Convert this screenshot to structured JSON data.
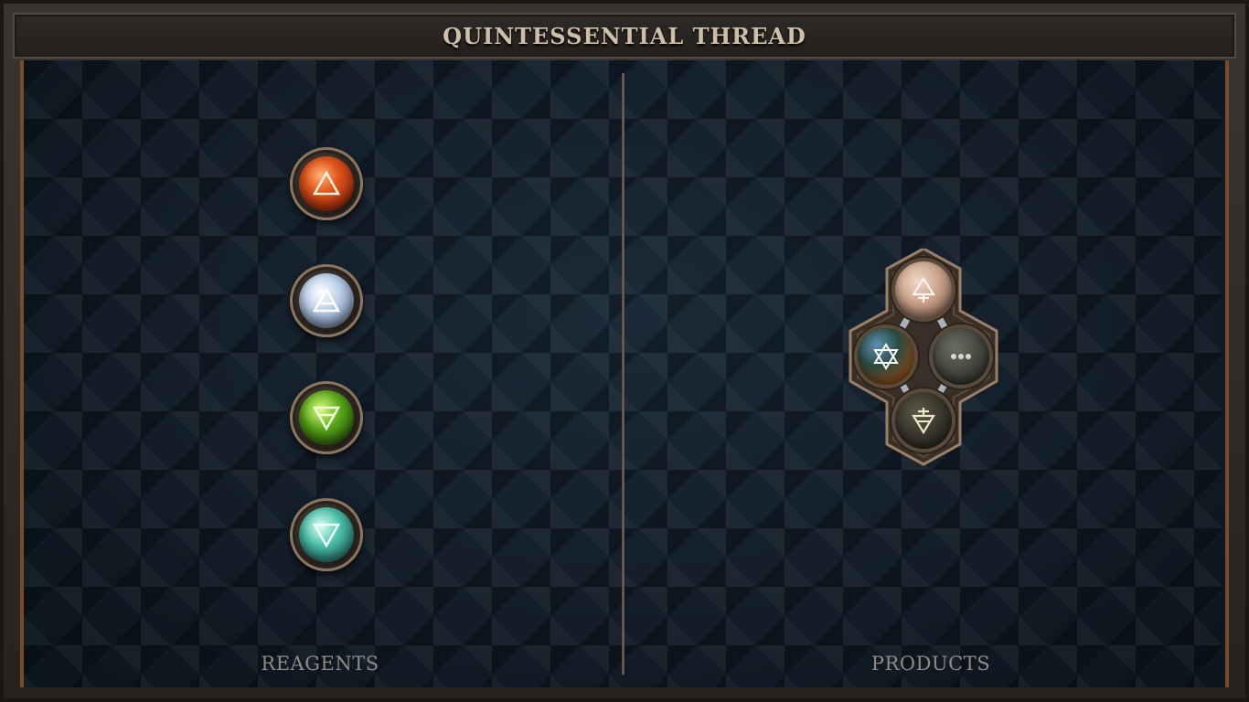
{
  "window": {
    "title": "QUINTESSENTIAL THREAD"
  },
  "panels": {
    "reagents_label": "REAGENTS",
    "products_label": "PRODUCTS"
  },
  "reagents": [
    {
      "element": "fire",
      "icon": "fire-triangle-icon"
    },
    {
      "element": "air",
      "icon": "air-triangle-icon"
    },
    {
      "element": "earth",
      "icon": "earth-triangle-icon"
    },
    {
      "element": "water",
      "icon": "water-triangle-icon"
    }
  ],
  "product": {
    "atoms": [
      {
        "element": "salt-fire",
        "icon": "ascending-cross-triangle-icon"
      },
      {
        "element": "quintessence",
        "icon": "hexagram-icon"
      },
      {
        "element": "unknown",
        "icon": "ellipsis-icon"
      },
      {
        "element": "salt-earth",
        "icon": "descending-cross-triangle-icon"
      }
    ]
  },
  "colors": {
    "board": "#101a24",
    "frame": "#2a2623",
    "accent_copper": "#7a4a2a",
    "label_text": "#8f8a86",
    "title_text": "#cdbfa8"
  }
}
